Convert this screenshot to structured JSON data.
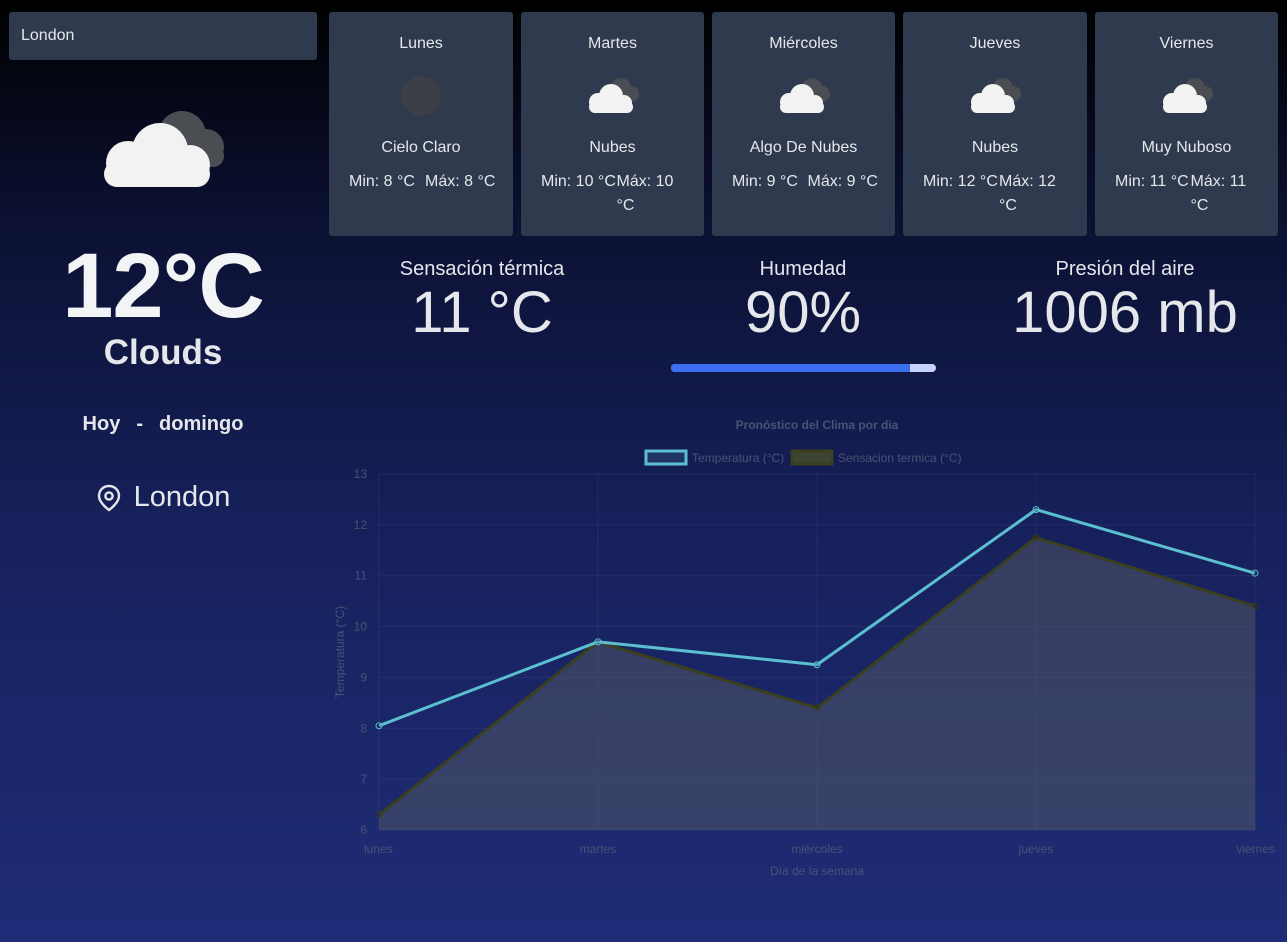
{
  "search": {
    "value": "London"
  },
  "current": {
    "icon": "clouds-icon",
    "temperature": "12°C",
    "condition": "Clouds",
    "today_label": "Hoy",
    "separator": "-",
    "weekday": "domingo",
    "location": "London"
  },
  "forecast": [
    {
      "day": "Lunes",
      "icon": "clear-sky-icon",
      "desc": "Cielo Claro",
      "min": "Min: 8 °C",
      "max": "Máx: 8 °C"
    },
    {
      "day": "Martes",
      "icon": "clouds-icon",
      "desc": "Nubes",
      "min": "Min: 10 °C",
      "max": "Máx: 10 °C"
    },
    {
      "day": "Miércoles",
      "icon": "clouds-icon",
      "desc": "Algo De Nubes",
      "min": "Min: 9 °C",
      "max": "Máx: 9 °C"
    },
    {
      "day": "Jueves",
      "icon": "clouds-icon",
      "desc": "Nubes",
      "min": "Min: 12 °C",
      "max": "Máx: 12 °C"
    },
    {
      "day": "Viernes",
      "icon": "clouds-icon",
      "desc": "Muy Nuboso",
      "min": "Min: 11 °C",
      "max": "Máx: 11 °C"
    }
  ],
  "stats": {
    "feels_like_label": "Sensación térmica",
    "feels_like_value": "11 °C",
    "humidity_label": "Humedad",
    "humidity_value": "90%",
    "humidity_fraction": 0.9,
    "pressure_label": "Presión del aire",
    "pressure_value": "1006 mb"
  },
  "colors": {
    "card_bg": "#2f3a4f",
    "humidity_fill": "#3b6ef0",
    "humidity_track": "#c6d4fb",
    "series_temp": "#5bbfcf",
    "series_feels": "#3a3f1f"
  },
  "chart_data": {
    "type": "line",
    "title": "Pronóstico del Clima por dia",
    "xlabel": "Día de la semana",
    "ylabel": "Temperatura (°C)",
    "categories": [
      "lunes",
      "martes",
      "miércoles",
      "jueves",
      "viernes"
    ],
    "ylim": [
      6,
      13
    ],
    "yticks": [
      6,
      7,
      8,
      9,
      10,
      11,
      12,
      13
    ],
    "grid": true,
    "legend": "top",
    "series": [
      {
        "name": "Temperatura (°C)",
        "values": [
          8.05,
          9.7,
          9.25,
          12.3,
          11.05
        ],
        "fill": false
      },
      {
        "name": "Sensacion termica (°C)",
        "values": [
          6.3,
          9.7,
          8.4,
          11.75,
          10.4
        ],
        "fill": true
      }
    ]
  }
}
